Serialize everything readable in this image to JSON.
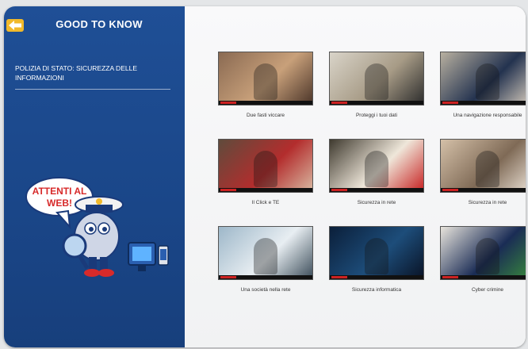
{
  "sidebar": {
    "title": "GOOD TO KNOW",
    "heading": "POLIZIA DI STATO: SICUREZZA DELLE INFORMAZIONI",
    "mascot_text_1": "ATTENTI AL",
    "mascot_text_2": "WEB!"
  },
  "videos": [
    {
      "caption": "Due fasti viccare",
      "scene": "people-room"
    },
    {
      "caption": "Proteggi i tuoi dati",
      "scene": "office-two"
    },
    {
      "caption": "Una navigazione responsabile",
      "scene": "officer"
    },
    {
      "caption": "Il Click e TE",
      "scene": "woman-red"
    },
    {
      "caption": "Sicurezza in rete",
      "scene": "man-banner"
    },
    {
      "caption": "Sicurezza in rete",
      "scene": "man-smile"
    },
    {
      "caption": "Una società nella rete",
      "scene": "laptop"
    },
    {
      "caption": "Sicurezza informatica",
      "scene": "dark-screen"
    },
    {
      "caption": "Cyber crimine",
      "scene": "officer-flags"
    }
  ],
  "colors": {
    "sidebar_blue": "#1f4f96",
    "back_arrow": "#f1b92b",
    "progress_red": "#cc2222"
  }
}
